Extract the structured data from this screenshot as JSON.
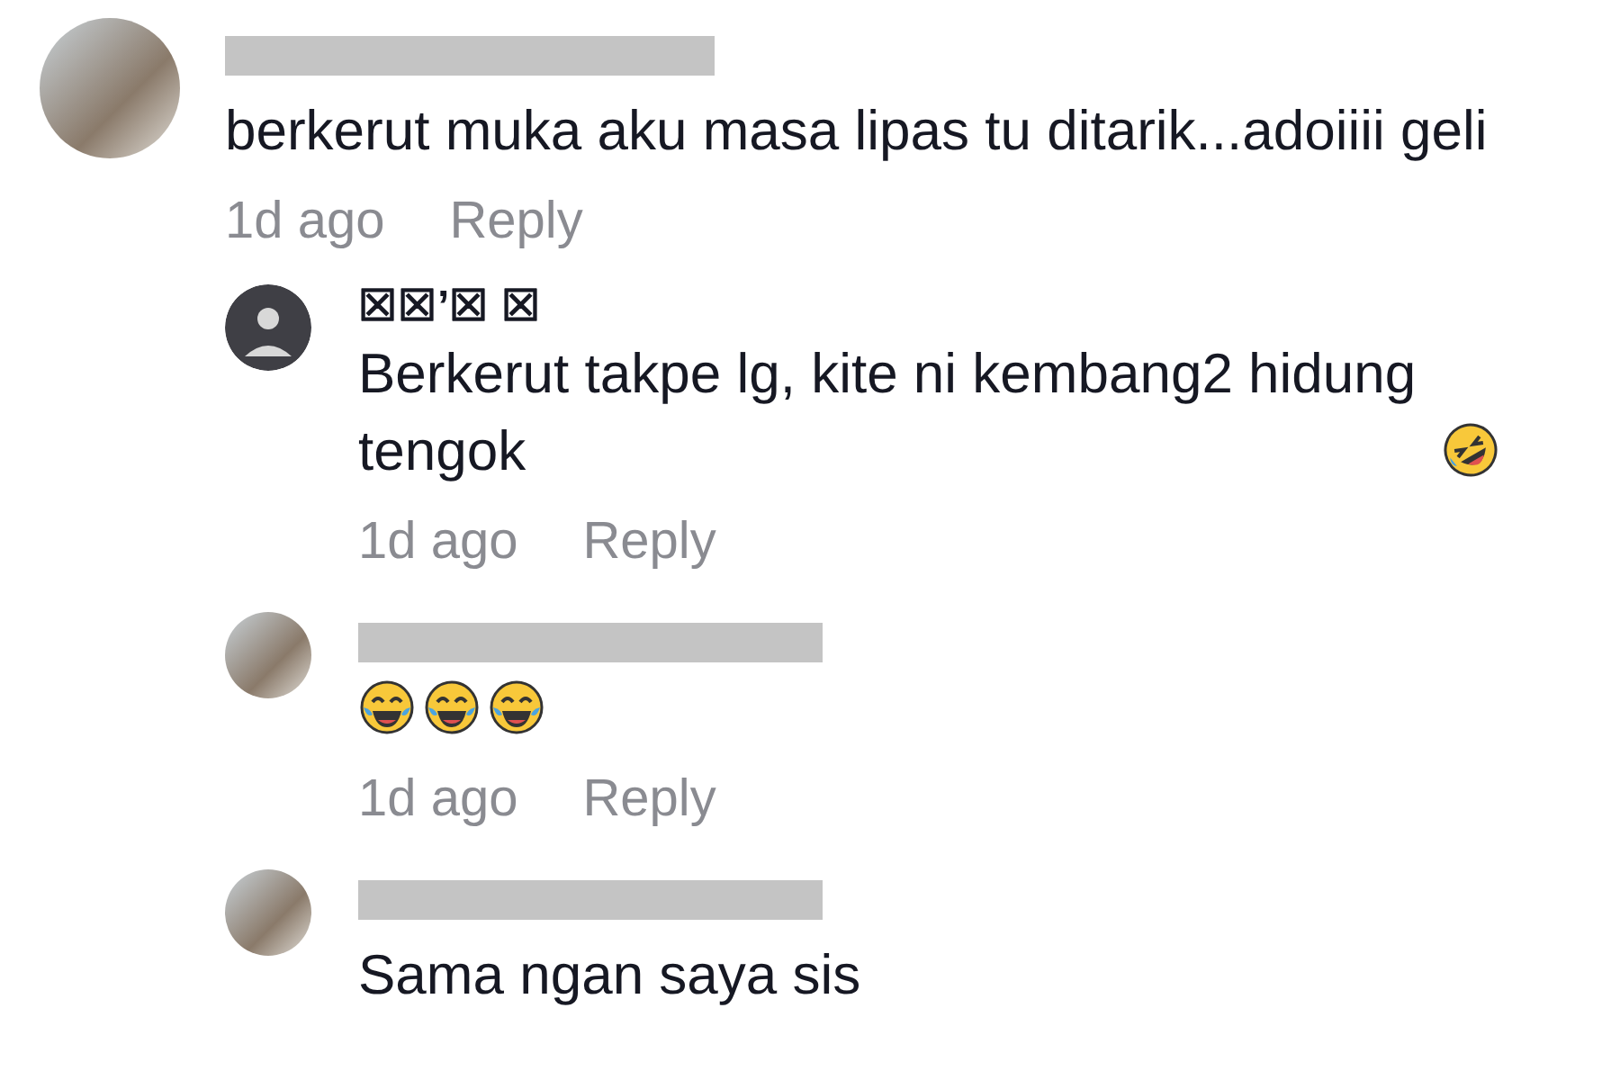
{
  "comments": [
    {
      "avatar": {
        "kind": "photo"
      },
      "name_redacted": true,
      "text": "berkerut muka aku masa lipas tu ditarik...adoiiii geli",
      "time": "1d ago",
      "reply_label": "Reply",
      "replies": [
        {
          "avatar": {
            "kind": "default"
          },
          "name_redacted": false,
          "name": "☒☒’☒ ☒",
          "text": "Berkerut takpe lg, kite ni kembang2 hidung tengok",
          "emojis": [
            {
              "kind": "rolling-laughing"
            }
          ],
          "time": "1d ago",
          "reply_label": "Reply"
        },
        {
          "avatar": {
            "kind": "photo"
          },
          "name_redacted": true,
          "emojis": [
            {
              "kind": "tears-of-joy"
            },
            {
              "kind": "tears-of-joy"
            },
            {
              "kind": "tears-of-joy"
            }
          ],
          "time": "1d ago",
          "reply_label": "Reply"
        },
        {
          "avatar": {
            "kind": "photo"
          },
          "name_redacted": true,
          "text": "Sama ngan saya sis"
        }
      ]
    }
  ]
}
